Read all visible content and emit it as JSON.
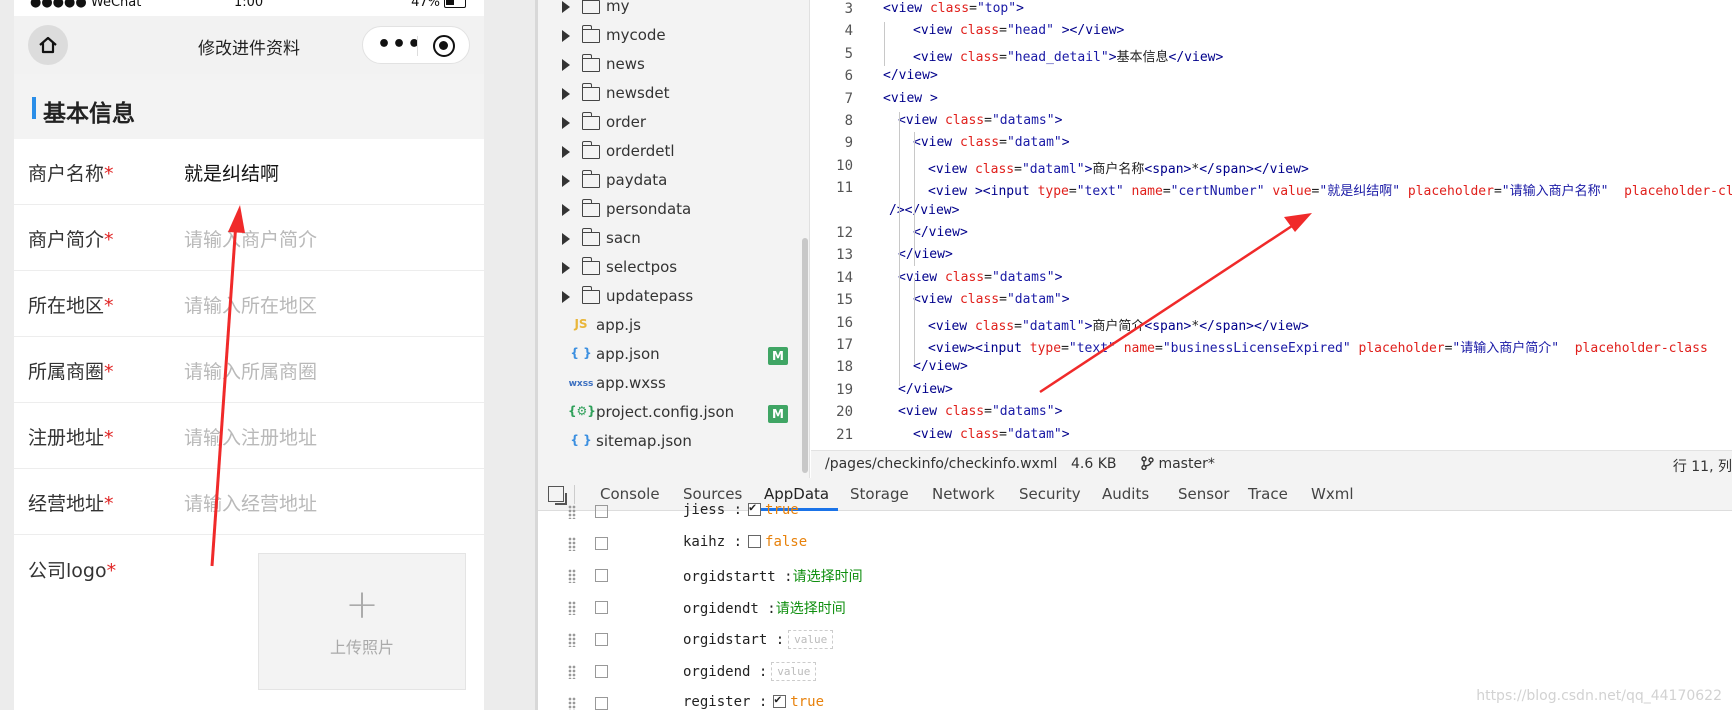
{
  "phone": {
    "status": {
      "carrier": "●●●●● WeChat",
      "time": "1:00",
      "battery": "47%"
    },
    "nav_title": "修改进件资料",
    "section_title": "基本信息",
    "rows": [
      {
        "label": "商户名称",
        "req": "*",
        "value": "就是纠结啊",
        "placeholder": false
      },
      {
        "label": "商户简介",
        "req": "*",
        "value": "请输入商户简介",
        "placeholder": true
      },
      {
        "label": "所在地区",
        "req": "*",
        "value": "请输入所在地区",
        "placeholder": true
      },
      {
        "label": "所属商圈",
        "req": "*",
        "value": "请输入所属商圈",
        "placeholder": true
      },
      {
        "label": "注册地址",
        "req": "*",
        "value": "请输入注册地址",
        "placeholder": true
      },
      {
        "label": "经营地址",
        "req": "*",
        "value": "请输入经营地址",
        "placeholder": true
      }
    ],
    "logo_label": "公司logo",
    "logo_req": "*",
    "upload_plus": "+",
    "upload_text": "上传照片"
  },
  "tree": {
    "folders": [
      "my",
      "mycode",
      "news",
      "newsdet",
      "order",
      "orderdetl",
      "paydata",
      "persondata",
      "sacn",
      "selectpos",
      "updatepass"
    ],
    "files": [
      {
        "name": "app.js",
        "icon": "JS",
        "icon_color": "#e9b63a",
        "badge": ""
      },
      {
        "name": "app.json",
        "icon": "{ }",
        "icon_color": "#3b8fe0",
        "badge": "M"
      },
      {
        "name": "app.wxss",
        "icon": "wxss",
        "icon_color": "#3b6fc0",
        "badge": ""
      },
      {
        "name": "project.config.json",
        "icon": "{⚙}",
        "icon_color": "#2fa05a",
        "badge": "M"
      },
      {
        "name": "sitemap.json",
        "icon": "{ }",
        "icon_color": "#3b8fe0",
        "badge": ""
      }
    ]
  },
  "editor": {
    "lines": [
      {
        "n": "3",
        "indent": 0,
        "parts": [
          [
            "t",
            "<view "
          ],
          [
            "a",
            "class"
          ],
          [
            "x",
            "="
          ],
          [
            "s",
            "\"top\""
          ],
          [
            "t",
            ">"
          ]
        ]
      },
      {
        "n": "4",
        "indent": 1,
        "parts": [
          [
            "t",
            "<view "
          ],
          [
            "a",
            "class"
          ],
          [
            "x",
            "="
          ],
          [
            "s",
            "\"head\""
          ],
          [
            "t",
            " ></view>"
          ]
        ]
      },
      {
        "n": "5",
        "indent": 1,
        "parts": [
          [
            "t",
            "<view "
          ],
          [
            "a",
            "class"
          ],
          [
            "x",
            "="
          ],
          [
            "s",
            "\"head_detail\""
          ],
          [
            "t",
            ">"
          ],
          [
            "x",
            "基本信息"
          ],
          [
            "t",
            "</view>"
          ]
        ]
      },
      {
        "n": "6",
        "indent": 0,
        "parts": [
          [
            "t",
            "</view>"
          ]
        ]
      },
      {
        "n": "7",
        "indent": 0,
        "parts": [
          [
            "t",
            "<view >"
          ]
        ]
      },
      {
        "n": "8",
        "indent": 0.5,
        "parts": [
          [
            "t",
            "<view "
          ],
          [
            "a",
            "class"
          ],
          [
            "x",
            "="
          ],
          [
            "s",
            "\"datams\""
          ],
          [
            "t",
            ">"
          ]
        ]
      },
      {
        "n": "9",
        "indent": 1,
        "parts": [
          [
            "t",
            "<view "
          ],
          [
            "a",
            "class"
          ],
          [
            "x",
            "="
          ],
          [
            "s",
            "\"datam\""
          ],
          [
            "t",
            ">"
          ]
        ]
      },
      {
        "n": "10",
        "indent": 1.5,
        "parts": [
          [
            "t",
            "<view "
          ],
          [
            "a",
            "class"
          ],
          [
            "x",
            "="
          ],
          [
            "s",
            "\"dataml\""
          ],
          [
            "t",
            ">"
          ],
          [
            "x",
            "商户名称"
          ],
          [
            "t",
            "<span>"
          ],
          [
            "x",
            "*"
          ],
          [
            "t",
            "</span></view>"
          ]
        ]
      },
      {
        "n": "11",
        "indent": 1.5,
        "parts": [
          [
            "t",
            "<view ><input "
          ],
          [
            "a",
            "type"
          ],
          [
            "x",
            "="
          ],
          [
            "s",
            "\"text\" "
          ],
          [
            "a",
            "name"
          ],
          [
            "x",
            "="
          ],
          [
            "s",
            "\"certNumber\" "
          ],
          [
            "a",
            "value"
          ],
          [
            "x",
            "="
          ],
          [
            "s",
            "\"就是纠结啊\" "
          ],
          [
            "a",
            "placeholder"
          ],
          [
            "x",
            "="
          ],
          [
            "s",
            "\"请输入商户名称\"  "
          ],
          [
            "a",
            "placeholder-class"
          ]
        ]
      },
      {
        "n": "",
        "indent": -1,
        "parts": [
          [
            "t",
            "/></view>"
          ]
        ]
      },
      {
        "n": "12",
        "indent": 1,
        "parts": [
          [
            "t",
            "</view>"
          ]
        ]
      },
      {
        "n": "13",
        "indent": 0.5,
        "parts": [
          [
            "t",
            "</view>"
          ]
        ]
      },
      {
        "n": "14",
        "indent": 0.5,
        "parts": [
          [
            "t",
            "<view "
          ],
          [
            "a",
            "class"
          ],
          [
            "x",
            "="
          ],
          [
            "s",
            "\"datams\""
          ],
          [
            "t",
            ">"
          ]
        ]
      },
      {
        "n": "15",
        "indent": 1,
        "parts": [
          [
            "t",
            "<view "
          ],
          [
            "a",
            "class"
          ],
          [
            "x",
            "="
          ],
          [
            "s",
            "\"datam\""
          ],
          [
            "t",
            ">"
          ]
        ]
      },
      {
        "n": "16",
        "indent": 1.5,
        "parts": [
          [
            "t",
            "<view "
          ],
          [
            "a",
            "class"
          ],
          [
            "x",
            "="
          ],
          [
            "s",
            "\"dataml\""
          ],
          [
            "t",
            ">"
          ],
          [
            "x",
            "商户简介"
          ],
          [
            "t",
            "<span>"
          ],
          [
            "x",
            "*"
          ],
          [
            "t",
            "</span></view>"
          ]
        ]
      },
      {
        "n": "17",
        "indent": 1.5,
        "parts": [
          [
            "t",
            "<view><input "
          ],
          [
            "a",
            "type"
          ],
          [
            "x",
            "="
          ],
          [
            "s",
            "\"text\" "
          ],
          [
            "a",
            "name"
          ],
          [
            "x",
            "="
          ],
          [
            "s",
            "\"businessLicenseExpired\" "
          ],
          [
            "a",
            "placeholder"
          ],
          [
            "x",
            "="
          ],
          [
            "s",
            "\"请输入商户简介\"  "
          ],
          [
            "a",
            "placeholder-class"
          ]
        ]
      },
      {
        "n": "18",
        "indent": 1,
        "parts": [
          [
            "t",
            "</view>"
          ]
        ]
      },
      {
        "n": "19",
        "indent": 0.5,
        "parts": [
          [
            "t",
            "</view>"
          ]
        ]
      },
      {
        "n": "20",
        "indent": 0.5,
        "parts": [
          [
            "t",
            "<view "
          ],
          [
            "a",
            "class"
          ],
          [
            "x",
            "="
          ],
          [
            "s",
            "\"datams\""
          ],
          [
            "t",
            ">"
          ]
        ]
      },
      {
        "n": "21",
        "indent": 1,
        "parts": [
          [
            "t",
            "<view "
          ],
          [
            "a",
            "class"
          ],
          [
            "x",
            "="
          ],
          [
            "s",
            "\"datam\""
          ],
          [
            "t",
            ">"
          ]
        ]
      }
    ],
    "status_path": "/pages/checkinfo/checkinfo.wxml",
    "status_size": "4.6 KB",
    "status_branch": "master*",
    "status_pos": "行 11, 列"
  },
  "devtools": {
    "tabs": [
      "Console",
      "Sources",
      "AppData",
      "Storage",
      "Network",
      "Security",
      "Audits",
      "Sensor",
      "Trace",
      "Wxml"
    ],
    "active_tab": "AppData",
    "rows": [
      {
        "key": "jiess",
        "kind": "bool",
        "checked": true,
        "value": "true"
      },
      {
        "key": "kaihz",
        "kind": "bool",
        "checked": false,
        "value": "false"
      },
      {
        "key": "orgidstartt",
        "kind": "str",
        "value": "请选择时间"
      },
      {
        "key": "orgidendt",
        "kind": "str",
        "value": "请选择时间"
      },
      {
        "key": "orgidstart",
        "kind": "empty",
        "value": "value"
      },
      {
        "key": "orgidend",
        "kind": "empty",
        "value": "value"
      },
      {
        "key": "register",
        "kind": "bool",
        "checked": true,
        "value": "true"
      }
    ],
    "watermark": "https://blog.csdn.net/qq_44170622"
  },
  "colors": {
    "annotation_arrow": "#f02a2a",
    "accent": "#2a8ee8",
    "badge": "#3fa564"
  }
}
